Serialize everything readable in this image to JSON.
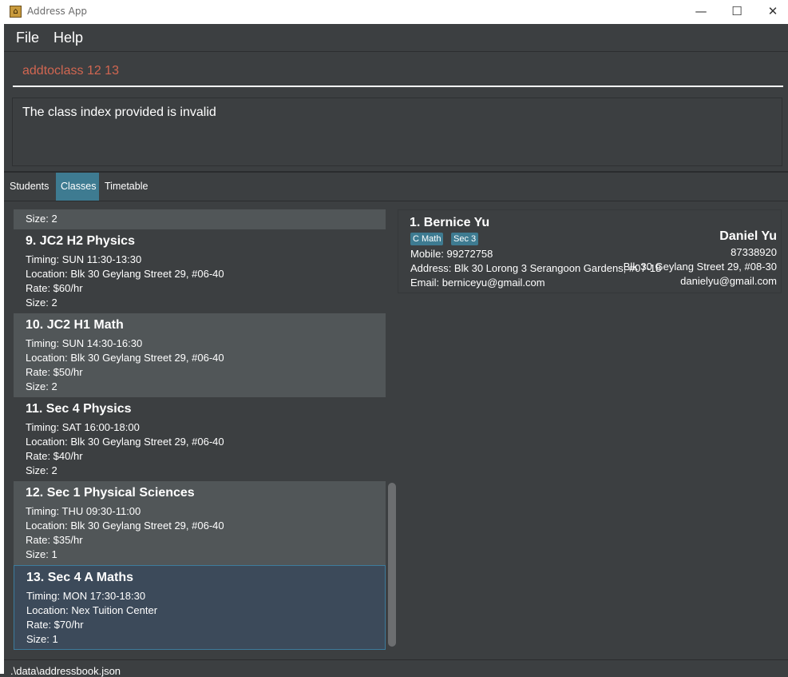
{
  "window": {
    "title": "Address App",
    "minimize": "—",
    "maximize": "☐",
    "close": "✕"
  },
  "menu": {
    "file": "File",
    "help": "Help"
  },
  "command": {
    "value": "addtoclass 12 13"
  },
  "result": {
    "message": "The class index provided is invalid"
  },
  "tabs": [
    {
      "label": "Students"
    },
    {
      "label": "Classes"
    },
    {
      "label": "Timetable"
    }
  ],
  "class_list": {
    "partial_size": "Size: 2",
    "items": [
      {
        "title": "9.  JC2 H2 Physics",
        "timing": "Timing: SUN 11:30-13:30",
        "location": "Location: Blk 30 Geylang Street 29, #06-40",
        "rate": "Rate: $60/hr",
        "size": "Size: 2"
      },
      {
        "title": "10.  JC2 H1 Math",
        "timing": "Timing: SUN 14:30-16:30",
        "location": "Location: Blk 30 Geylang Street 29, #06-40",
        "rate": "Rate: $50/hr",
        "size": "Size: 2"
      },
      {
        "title": "11.  Sec 4 Physics",
        "timing": "Timing: SAT 16:00-18:00",
        "location": "Location: Blk 30 Geylang Street 29, #06-40",
        "rate": "Rate: $40/hr",
        "size": "Size: 2"
      },
      {
        "title": "12.  Sec 1 Physical Sciences",
        "timing": "Timing: THU 09:30-11:00",
        "location": "Location: Blk 30 Geylang Street 29, #06-40",
        "rate": "Rate: $35/hr",
        "size": "Size: 1"
      },
      {
        "title": "13.  Sec 4 A Maths",
        "timing": "Timing: MON 17:30-18:30",
        "location": "Location: Nex Tuition Center",
        "rate": "Rate: $70/hr",
        "size": "Size: 1"
      }
    ]
  },
  "student": {
    "name": "1.  Bernice Yu",
    "tags": [
      "C Math",
      "Sec 3"
    ],
    "mobile": "Mobile: 99272758",
    "address": "Address: Blk 30 Lorong 3 Serangoon Gardens, #07-18",
    "email": "Email: berniceyu@gmail.com"
  },
  "overlay_person": {
    "name": "Daniel Yu",
    "phone": "87338920",
    "address": "Blk 30 Geylang Street 29, #08-30",
    "email": "danielyu@gmail.com"
  },
  "status": {
    "path": ".\\data\\addressbook.json"
  },
  "colors": {
    "accent": "#3e7b91",
    "command_text": "#d06651",
    "background": "#3c3f41"
  }
}
